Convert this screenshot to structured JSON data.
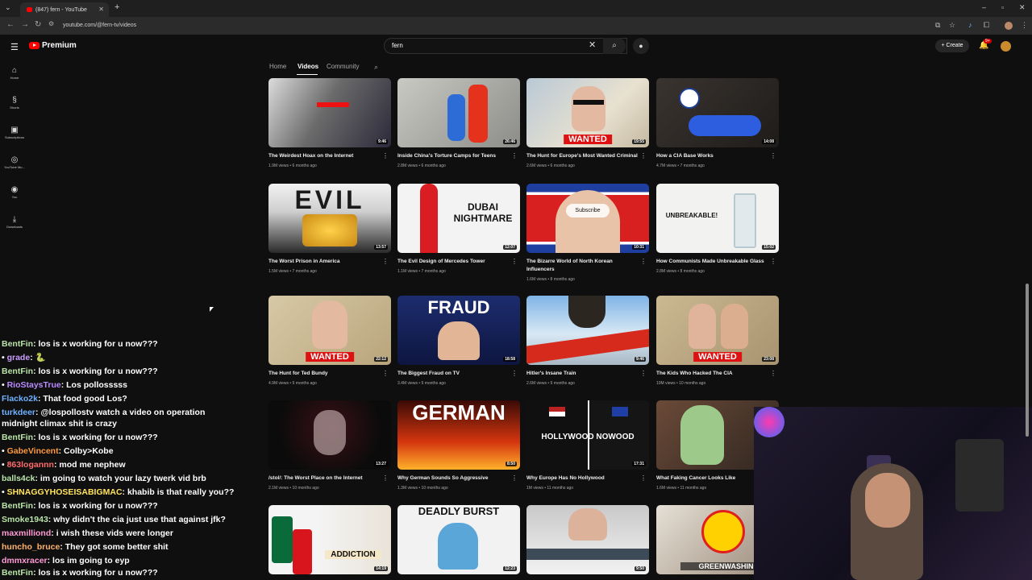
{
  "browser": {
    "tab_title": "(847) fern - YouTube",
    "url": "youtube.com/@fern-tv/videos"
  },
  "header": {
    "logo_text": "Premium",
    "search_value": "fern",
    "create_label": "Create",
    "notification_count": "9+"
  },
  "sidebar": {
    "items": [
      {
        "label": "Home",
        "icon": "home-icon"
      },
      {
        "label": "Shorts",
        "icon": "shorts-icon"
      },
      {
        "label": "Subscriptions",
        "icon": "subscriptions-icon"
      },
      {
        "label": "YouTube Mu...",
        "icon": "music-icon"
      },
      {
        "label": "You",
        "icon": "you-icon"
      },
      {
        "label": "Downloads",
        "icon": "download-icon"
      }
    ]
  },
  "channel_tabs": [
    "Home",
    "Videos",
    "Community"
  ],
  "videos": [
    {
      "title": "The Weirdest Hoax on the Internet",
      "meta": "1.9M views • 6 months ago",
      "duration": "9:46"
    },
    {
      "title": "Inside China's Torture Camps for Teens",
      "meta": "2.8M views • 6 months ago",
      "duration": "26:46"
    },
    {
      "title": "The Hunt for Europe's Most Wanted Criminal",
      "meta": "2.6M views • 6 months ago",
      "duration": "19:55",
      "overlay": "WANTED"
    },
    {
      "title": "How a CIA Base Works",
      "meta": "4.7M views • 7 months ago",
      "duration": "14:08"
    },
    {
      "title": "The Worst Prison in America",
      "meta": "1.5M views • 7 months ago",
      "duration": "13:57",
      "overlay": "EVIL"
    },
    {
      "title": "The Evil Design of Mercedes Tower",
      "meta": "1.1M views • 7 months ago",
      "duration": "12:07",
      "overlay": "DUBAI NIGHTMARE"
    },
    {
      "title": "The Bizarre World of North Korean Influencers",
      "meta": "1.6M views • 8 months ago",
      "duration": "10:31",
      "overlay": "Subscribe"
    },
    {
      "title": "How Communists Made Unbreakable Glass",
      "meta": "2.8M views • 8 months ago",
      "duration": "15:02",
      "overlay": "UNBREAKABLE!"
    },
    {
      "title": "The Hunt for Ted Bundy",
      "meta": "4.9M views • 9 months ago",
      "duration": "22:12",
      "overlay": "WANTED"
    },
    {
      "title": "The Biggest Fraud on TV",
      "meta": "3.4M views • 9 months ago",
      "duration": "18:58",
      "overlay": "FRAUD"
    },
    {
      "title": "Hitler's Insane Train",
      "meta": "2.6M views • 9 months ago",
      "duration": "9:46"
    },
    {
      "title": "The Kids Who Hacked The CIA",
      "meta": "10M views • 10 months ago",
      "duration": "23:08",
      "overlay": "WANTED"
    },
    {
      "title": "/stol/: The Worst Place on the Internet",
      "meta": "2.1M views • 10 months ago",
      "duration": "13:27"
    },
    {
      "title": "Why German Sounds So Aggressive",
      "meta": "1.3M views • 10 months ago",
      "duration": "8:50",
      "overlay": "GERMAN"
    },
    {
      "title": "Why Europe Has No Hollywood",
      "meta": "1M views • 11 months ago",
      "duration": "17:31",
      "overlay": "HOLLYWOOD NOWOOD"
    },
    {
      "title": "What Faking Cancer Looks Like",
      "meta": "1.6M views • 11 months ago",
      "duration": ""
    },
    {
      "title": "",
      "meta": "",
      "duration": "14:19",
      "overlay": "ADDICTION"
    },
    {
      "title": "",
      "meta": "",
      "duration": "12:23",
      "overlay": "DEADLY BURST"
    },
    {
      "title": "",
      "meta": "",
      "duration": "9:50"
    },
    {
      "title": "",
      "meta": "",
      "duration": "",
      "overlay": "GREENWASHING"
    }
  ],
  "chat": [
    {
      "user": "BentFin",
      "color": "#b9e4a8",
      "msg": "los is x working for u now???"
    },
    {
      "user": "grade",
      "color": "#c99bff",
      "msg": "🐍"
    },
    {
      "user": "BentFin",
      "color": "#b9e4a8",
      "msg": "los is x working for u now???"
    },
    {
      "user": "RioStaysTrue",
      "color": "#b88bff",
      "msg": "Los pollosssss"
    },
    {
      "user": "Flacko2k",
      "color": "#6fb1ff",
      "msg": "That food good Los?"
    },
    {
      "user": "turkdeer",
      "color": "#6fb1ff",
      "msg": "@lospollostv watch a video on operation"
    },
    {
      "user": "",
      "color": "#ffffff",
      "msg": "midnight climax shit is crazy"
    },
    {
      "user": "BentFin",
      "color": "#b9e4a8",
      "msg": "los is x working for u now???"
    },
    {
      "user": "GabeVincent",
      "color": "#ff9a3c",
      "msg": "Colby>Kobe"
    },
    {
      "user": "863logannn",
      "color": "#ff6b6b",
      "msg": "mod me nephew"
    },
    {
      "user": "balls4ck",
      "color": "#b9e4a8",
      "msg": "im going to watch your lazy twerk vid brb"
    },
    {
      "user": "SHNAGGYHOSEISABIGMAC",
      "color": "#ffe45c",
      "msg": "khabib is that really you??"
    },
    {
      "user": "BentFin",
      "color": "#b9e4a8",
      "msg": "los is x working for u now???"
    },
    {
      "user": "Smoke1943",
      "color": "#b9e4a8",
      "msg": "why didn't the cia just use that against jfk?"
    },
    {
      "user": "maxmilliond",
      "color": "#ff9ad5",
      "msg": "i wish these vids were longer"
    },
    {
      "user": "huncho_bruce",
      "color": "#ffb36b",
      "msg": "They got some better shit"
    },
    {
      "user": "dmmxracer",
      "color": "#ff9ad5",
      "msg": "los im going to eyp"
    },
    {
      "user": "BentFin",
      "color": "#b9e4a8",
      "msg": "los is x working for u now???"
    }
  ]
}
